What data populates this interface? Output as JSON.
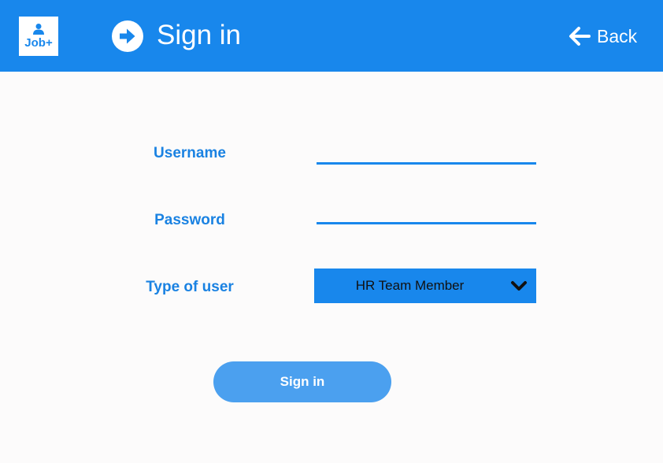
{
  "header": {
    "logo_text": "Job+",
    "title": "Sign in",
    "back_label": "Back"
  },
  "form": {
    "username_label": "Username",
    "username_value": "",
    "password_label": "Password",
    "password_value": "",
    "user_type_label": "Type of user",
    "user_type_value": "HR Team Member"
  },
  "actions": {
    "signin_label": "Sign in"
  },
  "icons": {
    "logo": "person-icon",
    "title": "arrow-right-circle-icon",
    "back": "arrow-left-icon",
    "dropdown": "chevron-down-icon"
  },
  "colors": {
    "primary": "#1887ec",
    "button": "#4ba0ef",
    "label": "#1a82e2",
    "background": "#fcfbfb"
  }
}
